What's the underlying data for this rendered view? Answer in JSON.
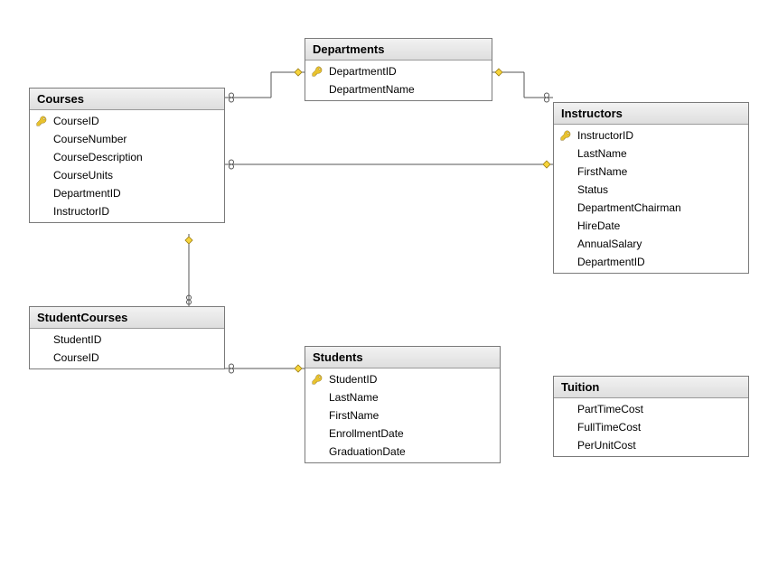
{
  "tables": {
    "courses": {
      "title": "Courses",
      "columns": [
        {
          "name": "CourseID",
          "pk": true
        },
        {
          "name": "CourseNumber",
          "pk": false
        },
        {
          "name": "CourseDescription",
          "pk": false
        },
        {
          "name": "CourseUnits",
          "pk": false
        },
        {
          "name": "DepartmentID",
          "pk": false
        },
        {
          "name": "InstructorID",
          "pk": false
        }
      ]
    },
    "departments": {
      "title": "Departments",
      "columns": [
        {
          "name": "DepartmentID",
          "pk": true
        },
        {
          "name": "DepartmentName",
          "pk": false
        }
      ]
    },
    "instructors": {
      "title": "Instructors",
      "columns": [
        {
          "name": "InstructorID",
          "pk": true
        },
        {
          "name": "LastName",
          "pk": false
        },
        {
          "name": "FirstName",
          "pk": false
        },
        {
          "name": "Status",
          "pk": false
        },
        {
          "name": "DepartmentChairman",
          "pk": false
        },
        {
          "name": "HireDate",
          "pk": false
        },
        {
          "name": "AnnualSalary",
          "pk": false
        },
        {
          "name": "DepartmentID",
          "pk": false
        }
      ]
    },
    "studentcourses": {
      "title": "StudentCourses",
      "columns": [
        {
          "name": "StudentID",
          "pk": false
        },
        {
          "name": "CourseID",
          "pk": false
        }
      ]
    },
    "students": {
      "title": "Students",
      "columns": [
        {
          "name": "StudentID",
          "pk": true
        },
        {
          "name": "LastName",
          "pk": false
        },
        {
          "name": "FirstName",
          "pk": false
        },
        {
          "name": "EnrollmentDate",
          "pk": false
        },
        {
          "name": "GraduationDate",
          "pk": false
        }
      ]
    },
    "tuition": {
      "title": "Tuition",
      "columns": [
        {
          "name": "PartTimeCost",
          "pk": false
        },
        {
          "name": "FullTimeCost",
          "pk": false
        },
        {
          "name": "PerUnitCost",
          "pk": false
        }
      ]
    }
  }
}
